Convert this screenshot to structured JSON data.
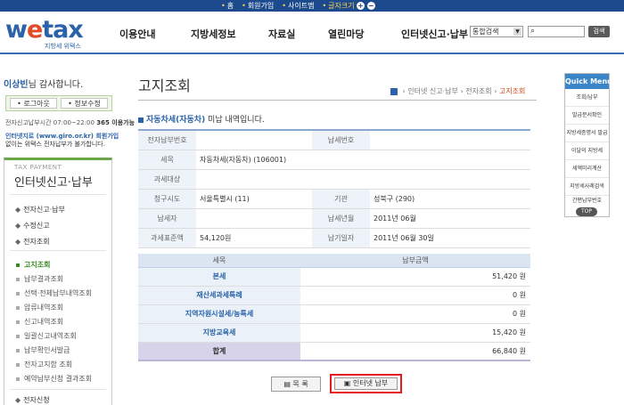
{
  "topbar": {
    "links": [
      "홈",
      "회원가입",
      "사이트맵"
    ],
    "font_size_label": "글자크기",
    "font_plus": "+",
    "font_minus": "−"
  },
  "header": {
    "logo_main_1": "w",
    "logo_main_e": "e",
    "logo_main_2": "tax",
    "logo_sub": "지방세 위택스",
    "nav": [
      "이용안내",
      "지방세정보",
      "자료실",
      "열린마당",
      "인터넷신고·납부"
    ],
    "search_select": "통합검색",
    "search_button": "검색"
  },
  "sidebar": {
    "welcome_name": "이상빈",
    "welcome_suffix": "님 감사합니다.",
    "logout": "로그아웃",
    "edit_info": "정보수정",
    "hours_prefix": "전자신고납부시간 07:00~22:00",
    "hours_bold": "365 이용가능",
    "giro_line1_blue": "인터넷지로 (www.giro.or.kr) 회원가입",
    "giro_line2": "없이는 위택스 전자납부가 불가합니다.",
    "box_caption": "TAX PAYMENT",
    "box_title": "인터넷신고·납부",
    "menu": [
      "전자신고·납부",
      "수정신고",
      "전자조회"
    ],
    "submenu": [
      "고지조회",
      "납부결과조회",
      "선택·전체납부내역조회",
      "압류내역조회",
      "신고내역조회",
      "일괄신고내역조회",
      "납부확인서발급",
      "전자고지함 조회",
      "예약납부신청 결과조회"
    ],
    "menu_bottom": "전자신청"
  },
  "main": {
    "page_title": "고지조회",
    "breadcrumb": [
      "인터넷 신고·납부",
      "전자조회",
      "고지조회"
    ],
    "notice_hl": "자동차세(자동차)",
    "notice_rest": " 미납 내역입니다.",
    "info": {
      "elec_no_label": "전자납부번호",
      "elec_no": "",
      "tax_no_label": "납세번호",
      "tax_no": "",
      "item_label": "세목",
      "item": "자동차세(자동차) (106001)",
      "target_label": "과세대상",
      "target": "",
      "city_label": "청구시도",
      "city": "서울특별시 (11)",
      "agency_label": "기관",
      "agency": "성북구 (290)",
      "payer_label": "납세자",
      "payer": "",
      "ym_label": "납세년월",
      "ym": "2011년 06월",
      "base_label": "과세표준액",
      "base": "54,120원",
      "due_label": "납기일자",
      "due": "2011년 06월 30일"
    },
    "amount_table": {
      "col_item": "세목",
      "col_amount": "납부금액",
      "rows": [
        {
          "label": "본세",
          "value": "51,420 원"
        },
        {
          "label": "재산세과세특례",
          "value": "0 원"
        },
        {
          "label": "지역자원시설세/농특세",
          "value": "0 원"
        },
        {
          "label": "지방교육세",
          "value": "15,420 원"
        }
      ],
      "total_label": "합계",
      "total_value": "66,840 원"
    },
    "btn_list": "목  록",
    "btn_pay": "인터넷 납부"
  },
  "quick_menu": {
    "title": "Quick Menu",
    "items": [
      "조회/납부",
      "발급문서확인",
      "지방세증명서 발급",
      "이달의 지방세",
      "세액미리계산",
      "지방세사례검색",
      "간편납부번호"
    ],
    "top": "TOP"
  }
}
